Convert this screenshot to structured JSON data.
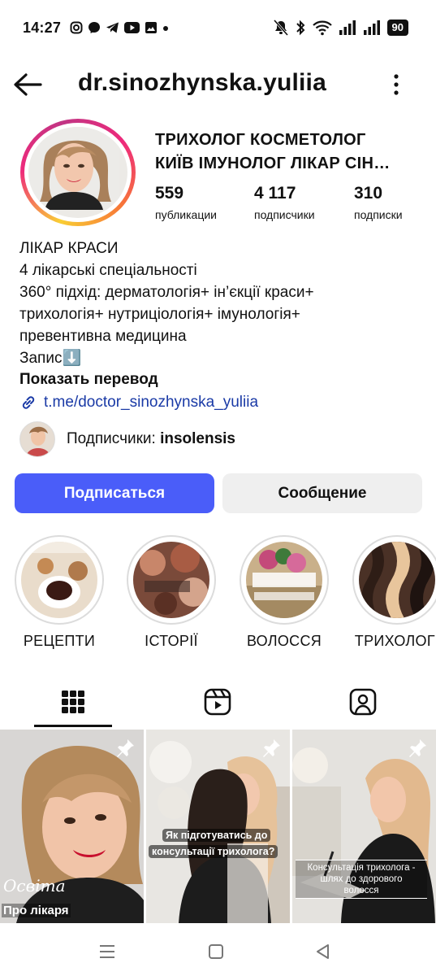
{
  "status_bar": {
    "time": "14:27",
    "battery": "90",
    "app_icons": [
      "instagram-icon",
      "messenger-icon",
      "telegram-icon",
      "youtube-icon",
      "gallery-icon",
      "dot-icon"
    ],
    "system_icons": [
      "mute-icon",
      "bluetooth-icon",
      "wifi-icon",
      "signal-icon",
      "signal-icon",
      "battery-icon"
    ]
  },
  "header": {
    "username": "dr.sinozhynska.yuliia",
    "back_icon": "arrow-left-icon",
    "more_icon": "more-vertical-icon"
  },
  "profile": {
    "full_name_line1": "ТРИХОЛОГ КОСМЕТОЛОГ",
    "full_name_line2": "КИЇВ ІМУНОЛОГ ЛІКАР СІН…",
    "stats": [
      {
        "value": "559",
        "label": "публикации"
      },
      {
        "value": "4 117",
        "label": "подписчики"
      },
      {
        "value": "310",
        "label": "подписки"
      }
    ],
    "bio_lines": [
      "ЛІКАР КРАСИ",
      "4 лікарські спеціальності",
      "360° підхід: дерматологія+ ін’єкції краси+",
      "трихологія+ нутриціологія+ імунологія+",
      "превентивна медицина",
      "Запис⬇️"
    ],
    "translate": "Показать перевод",
    "link": "t.me/doctor_sinozhynska_yuliia",
    "followers_prefix": "Подписчики: ",
    "followers_name": "insolensis"
  },
  "buttons": {
    "follow": "Подписаться",
    "message": "Сообщение"
  },
  "highlights": [
    {
      "label": "РЕЦЕПТИ"
    },
    {
      "label": "ІСТОРІЇ"
    },
    {
      "label": "ВОЛОССЯ"
    },
    {
      "label": "ТРИХОЛОГІ"
    }
  ],
  "tabs": [
    {
      "icon": "grid-icon",
      "active": true
    },
    {
      "icon": "reels-icon",
      "active": false
    },
    {
      "icon": "tagged-icon",
      "active": false
    }
  ],
  "posts": [
    {
      "caption_script": "Освіта",
      "caption": "Про лікаря",
      "pinned": true
    },
    {
      "caption_line1": "Як підготуватись до",
      "caption_line2": "консультації трихолога?",
      "pinned": true
    },
    {
      "caption_line1": "Консультація трихолога -",
      "caption_line2": "шлях до здорового",
      "caption_line3": "волосся",
      "pinned": true
    }
  ],
  "nav": [
    "menu-icon",
    "home-icon",
    "back-triangle-icon"
  ],
  "colors": {
    "primary_button": "#4a5df9",
    "secondary_button": "#efefef",
    "link": "#1a3aa6",
    "text": "#111111"
  }
}
